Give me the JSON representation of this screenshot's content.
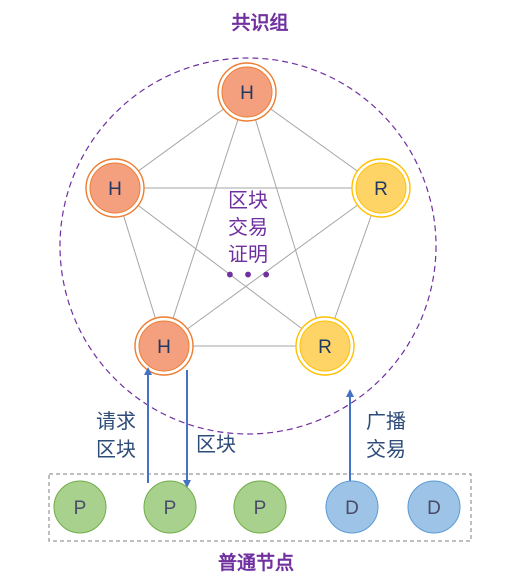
{
  "title_top": "共识组",
  "title_bottom": "普通节点",
  "center_label": [
    "区块",
    "交易",
    "证明"
  ],
  "ellipsis": "• • •",
  "labels": {
    "request_block": [
      "请求",
      "区块"
    ],
    "block": "区块",
    "broadcast_tx": [
      "广播",
      "交易"
    ]
  },
  "consensus_nodes": [
    "H",
    "H",
    "R",
    "H",
    "R"
  ],
  "ordinary_nodes": [
    "P",
    "P",
    "P",
    "D",
    "D"
  ],
  "colors": {
    "purple": "#7030a0",
    "arrow_blue": "#4472c4",
    "H_fill": "#f4a07e",
    "H_ring": "#ed7d31",
    "R_fill": "#ffd466",
    "R_ring": "#ffc000",
    "P_fill": "#a9d18e",
    "P_ring": "#70ad47",
    "D_fill": "#9dc3e6",
    "D_ring": "#5b9bd5"
  }
}
